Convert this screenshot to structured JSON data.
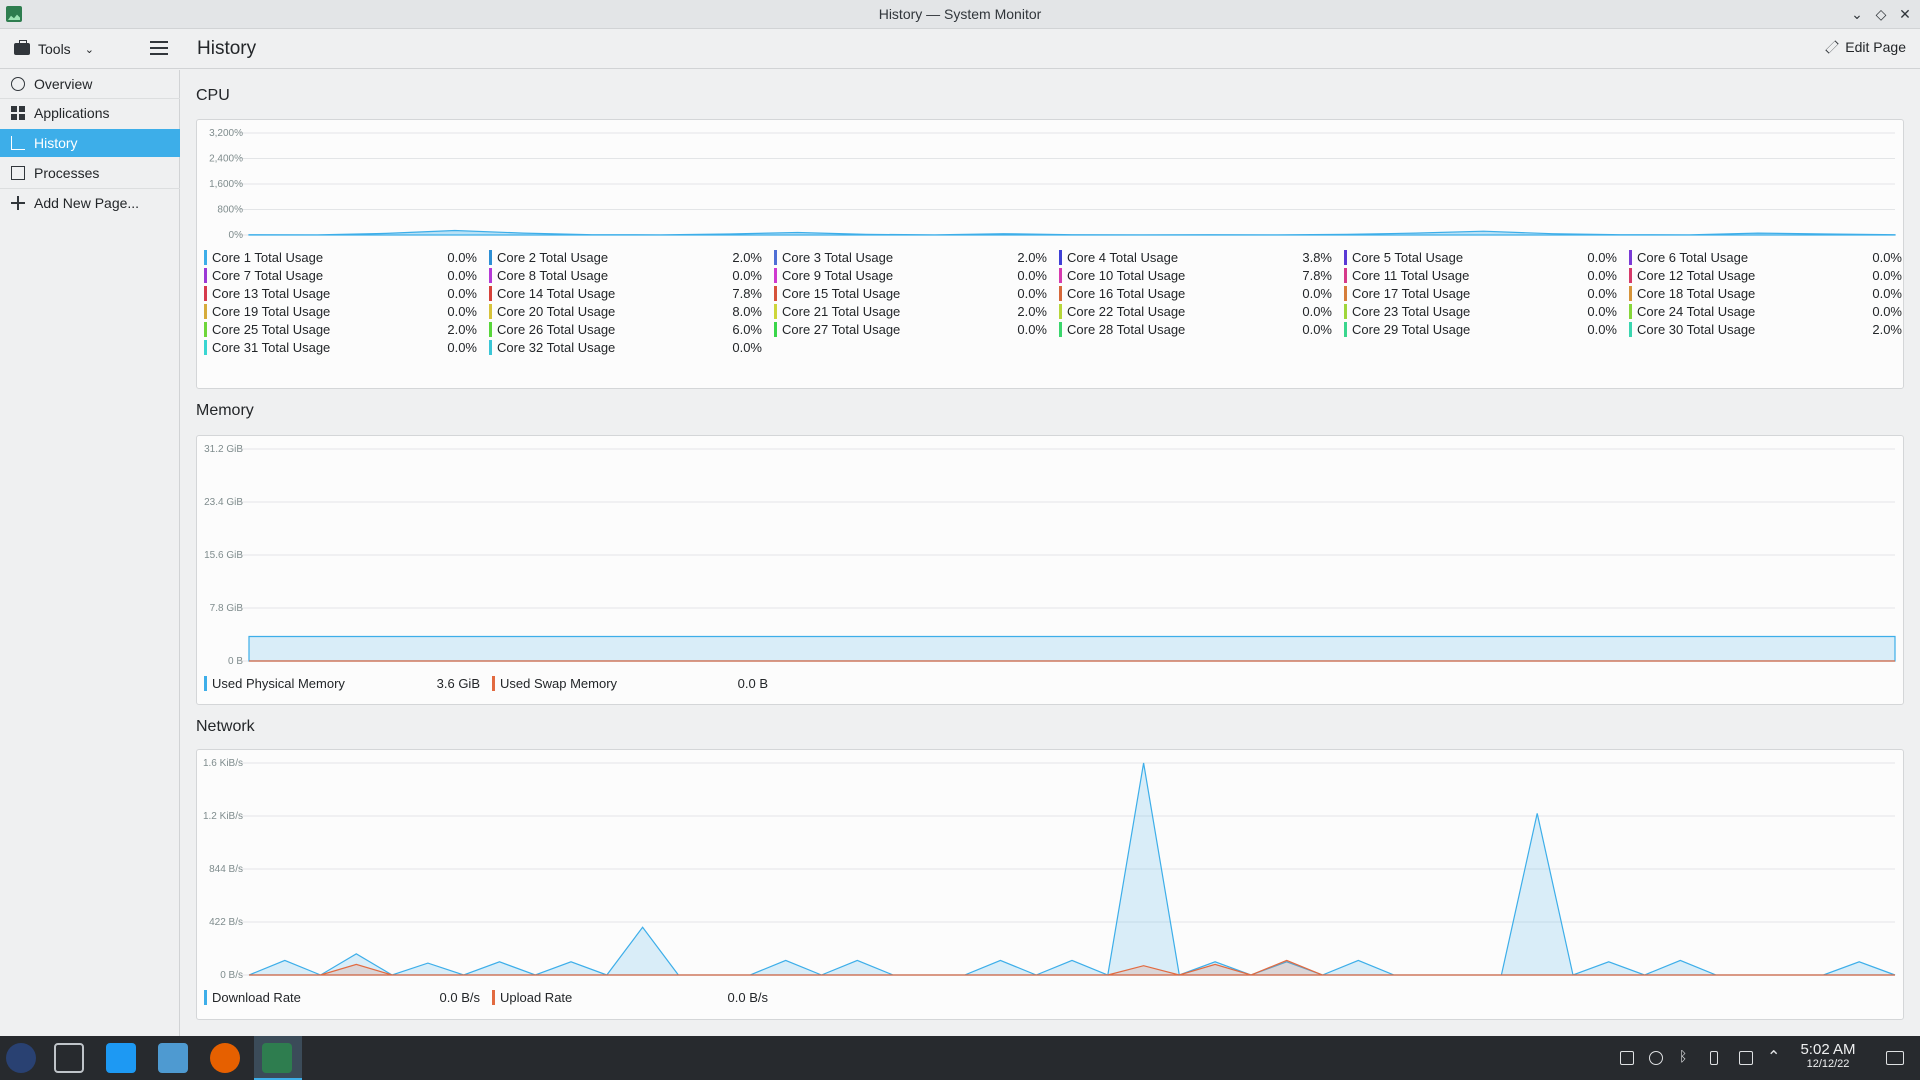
{
  "window": {
    "title": "History — System Monitor"
  },
  "toolbar": {
    "tools_label": "Tools",
    "page_title": "History",
    "edit_label": "Edit Page"
  },
  "sidebar": {
    "items": [
      {
        "label": "Overview",
        "icon": "overview-icon"
      },
      {
        "label": "Applications",
        "icon": "applications-icon"
      },
      {
        "label": "History",
        "icon": "history-icon",
        "active": true
      },
      {
        "label": "Processes",
        "icon": "processes-icon"
      },
      {
        "label": "Add New Page...",
        "icon": "add-icon"
      }
    ]
  },
  "colors": {
    "accent": "#3daee9",
    "download": "#3daee9",
    "upload": "#e26a40"
  },
  "sections": {
    "cpu": {
      "title": "CPU",
      "y_ticks": [
        "3,200%",
        "2,400%",
        "1,600%",
        "800%",
        "0%"
      ],
      "legend": [
        {
          "name": "Core 1 Total Usage",
          "value": "0.0%",
          "color": "#3daee9"
        },
        {
          "name": "Core 2 Total Usage",
          "value": "2.0%",
          "color": "#2d8fd5"
        },
        {
          "name": "Core 3 Total Usage",
          "value": "2.0%",
          "color": "#4f6fd6"
        },
        {
          "name": "Core 4 Total Usage",
          "value": "3.8%",
          "color": "#3e3fd6"
        },
        {
          "name": "Core 5 Total Usage",
          "value": "0.0%",
          "color": "#5a3ad6"
        },
        {
          "name": "Core 6 Total Usage",
          "value": "0.0%",
          "color": "#7a3ad6"
        },
        {
          "name": "Core 7 Total Usage",
          "value": "0.0%",
          "color": "#9b3ad6"
        },
        {
          "name": "Core 8 Total Usage",
          "value": "0.0%",
          "color": "#b53ad6"
        },
        {
          "name": "Core 9 Total Usage",
          "value": "0.0%",
          "color": "#cf3ad0"
        },
        {
          "name": "Core 10 Total Usage",
          "value": "7.8%",
          "color": "#d63aaf"
        },
        {
          "name": "Core 11 Total Usage",
          "value": "0.0%",
          "color": "#d63a8b"
        },
        {
          "name": "Core 12 Total Usage",
          "value": "0.0%",
          "color": "#d63a6a"
        },
        {
          "name": "Core 13 Total Usage",
          "value": "0.0%",
          "color": "#d63a4c"
        },
        {
          "name": "Core 14 Total Usage",
          "value": "7.8%",
          "color": "#d6413a"
        },
        {
          "name": "Core 15 Total Usage",
          "value": "0.0%",
          "color": "#d6523a"
        },
        {
          "name": "Core 16 Total Usage",
          "value": "0.0%",
          "color": "#d6683a"
        },
        {
          "name": "Core 17 Total Usage",
          "value": "0.0%",
          "color": "#d67d3a"
        },
        {
          "name": "Core 18 Total Usage",
          "value": "0.0%",
          "color": "#d6943a"
        },
        {
          "name": "Core 19 Total Usage",
          "value": "0.0%",
          "color": "#d6ab3a"
        },
        {
          "name": "Core 20 Total Usage",
          "value": "8.0%",
          "color": "#d6c23a"
        },
        {
          "name": "Core 21 Total Usage",
          "value": "2.0%",
          "color": "#cdd63a"
        },
        {
          "name": "Core 22 Total Usage",
          "value": "0.0%",
          "color": "#b6d63a"
        },
        {
          "name": "Core 23 Total Usage",
          "value": "0.0%",
          "color": "#9fd63a"
        },
        {
          "name": "Core 24 Total Usage",
          "value": "0.0%",
          "color": "#86d63a"
        },
        {
          "name": "Core 25 Total Usage",
          "value": "2.0%",
          "color": "#6fd63a"
        },
        {
          "name": "Core 26 Total Usage",
          "value": "6.0%",
          "color": "#58d63a"
        },
        {
          "name": "Core 27 Total Usage",
          "value": "0.0%",
          "color": "#3ad64a"
        },
        {
          "name": "Core 28 Total Usage",
          "value": "0.0%",
          "color": "#3ad66c"
        },
        {
          "name": "Core 29 Total Usage",
          "value": "0.0%",
          "color": "#3ad68e"
        },
        {
          "name": "Core 30 Total Usage",
          "value": "2.0%",
          "color": "#3ad6b0"
        },
        {
          "name": "Core 31 Total Usage",
          "value": "0.0%",
          "color": "#3ad6d2"
        },
        {
          "name": "Core 32 Total Usage",
          "value": "0.0%",
          "color": "#3ac6d6"
        }
      ]
    },
    "memory": {
      "title": "Memory",
      "y_ticks": [
        "31.2 GiB",
        "23.4 GiB",
        "15.6 GiB",
        "7.8 GiB",
        "0 B"
      ],
      "legend": [
        {
          "name": "Used Physical Memory",
          "value": "3.6 GiB",
          "color": "#3daee9"
        },
        {
          "name": "Used Swap Memory",
          "value": "0.0 B",
          "color": "#e26a40"
        }
      ]
    },
    "network": {
      "title": "Network",
      "y_ticks": [
        "1.6 KiB/s",
        "1.2 KiB/s",
        "844 B/s",
        "422 B/s",
        "0 B/s"
      ],
      "legend": [
        {
          "name": "Download Rate",
          "value": "0.0 B/s",
          "color": "#3daee9"
        },
        {
          "name": "Upload Rate",
          "value": "0.0 B/s",
          "color": "#e26a40"
        }
      ]
    }
  },
  "chart_data": [
    {
      "type": "line",
      "ylim": [
        0,
        3200
      ],
      "series": [
        {
          "name": "Core 1 Total Usage",
          "values": [
            10,
            5,
            50,
            140,
            60,
            10,
            5,
            30,
            80,
            20,
            5,
            40,
            10,
            5,
            10,
            5,
            20,
            60,
            120,
            40,
            10,
            5,
            60,
            30,
            10
          ]
        }
      ]
    },
    {
      "type": "area",
      "ylim": [
        0,
        31.2
      ],
      "series": [
        {
          "name": "Used Physical Memory",
          "values": [
            3.6,
            3.6,
            3.6,
            3.6,
            3.6,
            3.6,
            3.6,
            3.6,
            3.6,
            3.6
          ]
        },
        {
          "name": "Used Swap Memory",
          "values": [
            0,
            0,
            0,
            0,
            0,
            0,
            0,
            0,
            0,
            0
          ]
        }
      ]
    },
    {
      "type": "area",
      "ylim": [
        0,
        1.6
      ],
      "series": [
        {
          "name": "Download Rate",
          "values": [
            0,
            0.11,
            0,
            0.16,
            0,
            0.09,
            0,
            0.1,
            0,
            0.1,
            0,
            0.36,
            0,
            0,
            0,
            0.11,
            0,
            0.11,
            0,
            0,
            0,
            0.11,
            0,
            0.11,
            0,
            1.6,
            0,
            0.1,
            0,
            0.1,
            0,
            0.11,
            0,
            0,
            0,
            0,
            1.22,
            0,
            0.1,
            0,
            0.11,
            0,
            0,
            0,
            0,
            0.1,
            0
          ]
        },
        {
          "name": "Upload Rate",
          "values": [
            0,
            0,
            0,
            0.08,
            0,
            0,
            0,
            0,
            0,
            0,
            0,
            0,
            0,
            0,
            0,
            0,
            0,
            0,
            0,
            0,
            0,
            0,
            0,
            0,
            0,
            0.07,
            0,
            0.08,
            0,
            0.11,
            0,
            0,
            0,
            0,
            0,
            0,
            0,
            0,
            0,
            0,
            0,
            0,
            0,
            0,
            0,
            0,
            0
          ]
        }
      ]
    }
  ],
  "taskbar": {
    "clock_time": "5:02 AM",
    "clock_date": "12/12/22",
    "apps": [
      "fedora-launcher-icon",
      "task-manager-icon",
      "discover-icon",
      "files-icon",
      "firefox-icon",
      "system-monitor-icon"
    ]
  }
}
